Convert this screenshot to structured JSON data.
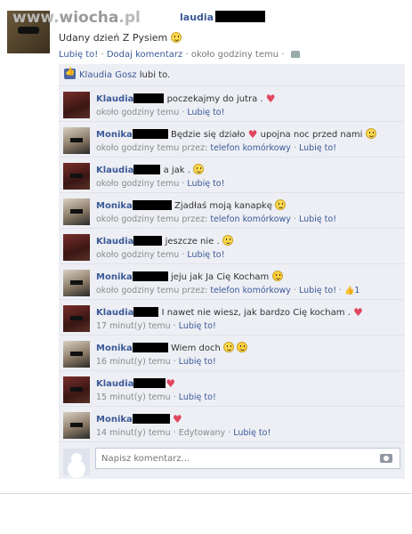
{
  "watermark": {
    "text_left": "www.",
    "text_mid": "wiocha",
    "text_right": ".pl"
  },
  "post": {
    "author_visible": "laudia",
    "text": "Udany dzień Z Pysiem",
    "meta": {
      "like": "Lubię to!",
      "sep1": "·",
      "comment": "Dodaj komentarz",
      "sep2": "·",
      "time": "około godziny temu",
      "sep3": "·"
    }
  },
  "likes": {
    "liker": "Klaudia Gosz",
    "text": "lubi to."
  },
  "comments": [
    {
      "name": "Klaudia",
      "text": "poczekajmy do jutra .",
      "time": "około godziny temu",
      "via": "",
      "like": "Lubię to!"
    },
    {
      "name": "Monika",
      "text": "Będzie się działo",
      "text2": "upojna noc przed nami",
      "time": "około godziny temu przez:",
      "via": "telefon komórkowy",
      "like": "Lubię to!"
    },
    {
      "name": "Klaudia",
      "text": "a jak .",
      "time": "około godziny temu",
      "via": "",
      "like": "Lubię to!"
    },
    {
      "name": "Monika",
      "text": "Zjadłaś moją kanapkę",
      "time": "około godziny temu przez:",
      "via": "telefon komórkowy",
      "like": "Lubię to!"
    },
    {
      "name": "Klaudia",
      "text": "jeszcze nie .",
      "time": "około godziny temu",
      "via": "",
      "like": "Lubię to!"
    },
    {
      "name": "Monika",
      "text": "jeju jak Ja Cię Kocham",
      "time": "około godziny temu przez:",
      "via": "telefon komórkowy",
      "like": "Lubię to!",
      "like_count": "1"
    },
    {
      "name": "Klaudia",
      "text": "I nawet nie wiesz, jak bardzo Cię kocham .",
      "time": "17 minut(y) temu",
      "via": "",
      "like": "Lubię to!"
    },
    {
      "name": "Monika",
      "text": "Wiem doch",
      "time": "16 minut(y) temu",
      "via": "",
      "like": "Lubię to!"
    },
    {
      "name": "Klaudia",
      "text": "",
      "time": "15 minut(y) temu",
      "via": "",
      "like": "Lubię to!"
    },
    {
      "name": "Monika",
      "text": "",
      "time": "14 minut(y) temu",
      "edited": "Edytowany",
      "via": "",
      "like": "Lubię to!"
    }
  ],
  "write": {
    "placeholder": "Napisz komentarz..."
  },
  "colors": {
    "link": "#3b5998",
    "panel": "#edeff4",
    "heart": "#e0465f"
  }
}
